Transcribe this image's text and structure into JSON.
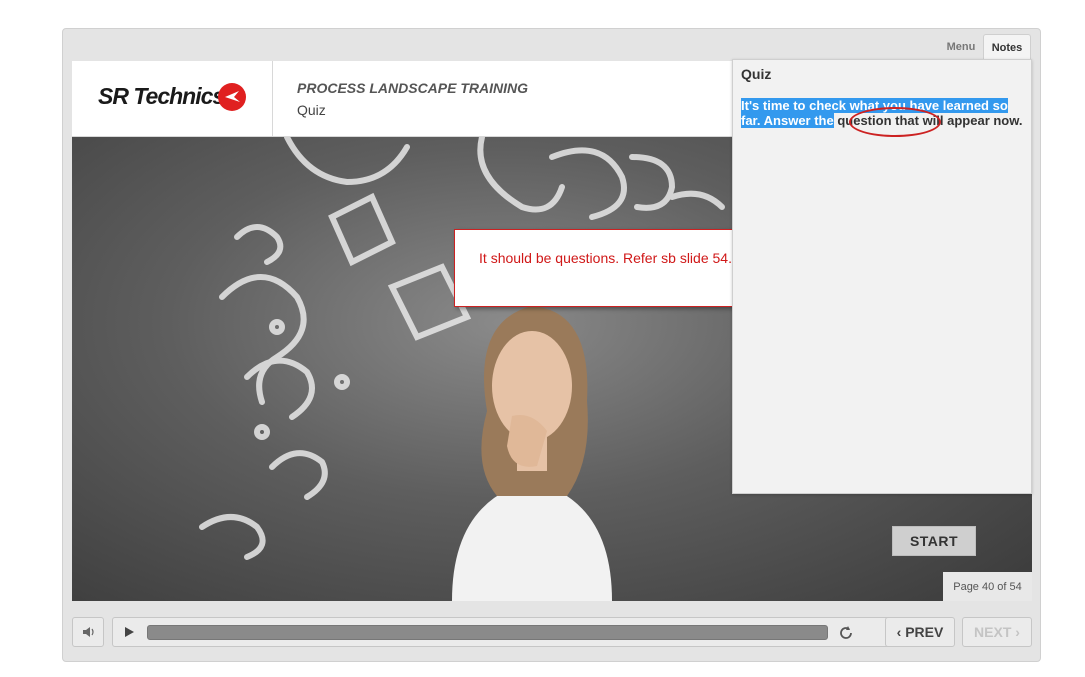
{
  "header": {
    "logo_text": "SR Technics",
    "course_title": "PROCESS LANDSCAPE TRAINING",
    "slide_title": "Quiz"
  },
  "comment": {
    "text": "It should be questions. Refer sb slide 54."
  },
  "start_button": {
    "label": "START"
  },
  "page_indicator": {
    "text": "Page 40 of 54"
  },
  "tabs": [
    {
      "label": "Menu",
      "active": false
    },
    {
      "label": "Notes",
      "active": true
    }
  ],
  "notes": {
    "heading": "Quiz",
    "text_part1": "It's time to check what you have learned so far. Answer the",
    "text_word": "question",
    "text_part2": " that will appear now."
  },
  "controls": {
    "prev_label": "PREV",
    "next_label": "NEXT",
    "progress": 0.0
  },
  "icons": [
    "volume-icon",
    "play-icon",
    "replay-icon",
    "chevron-left-icon",
    "chevron-right-icon"
  ],
  "colors": {
    "accent_red": "#cc2222",
    "highlight": "#3399ee"
  }
}
